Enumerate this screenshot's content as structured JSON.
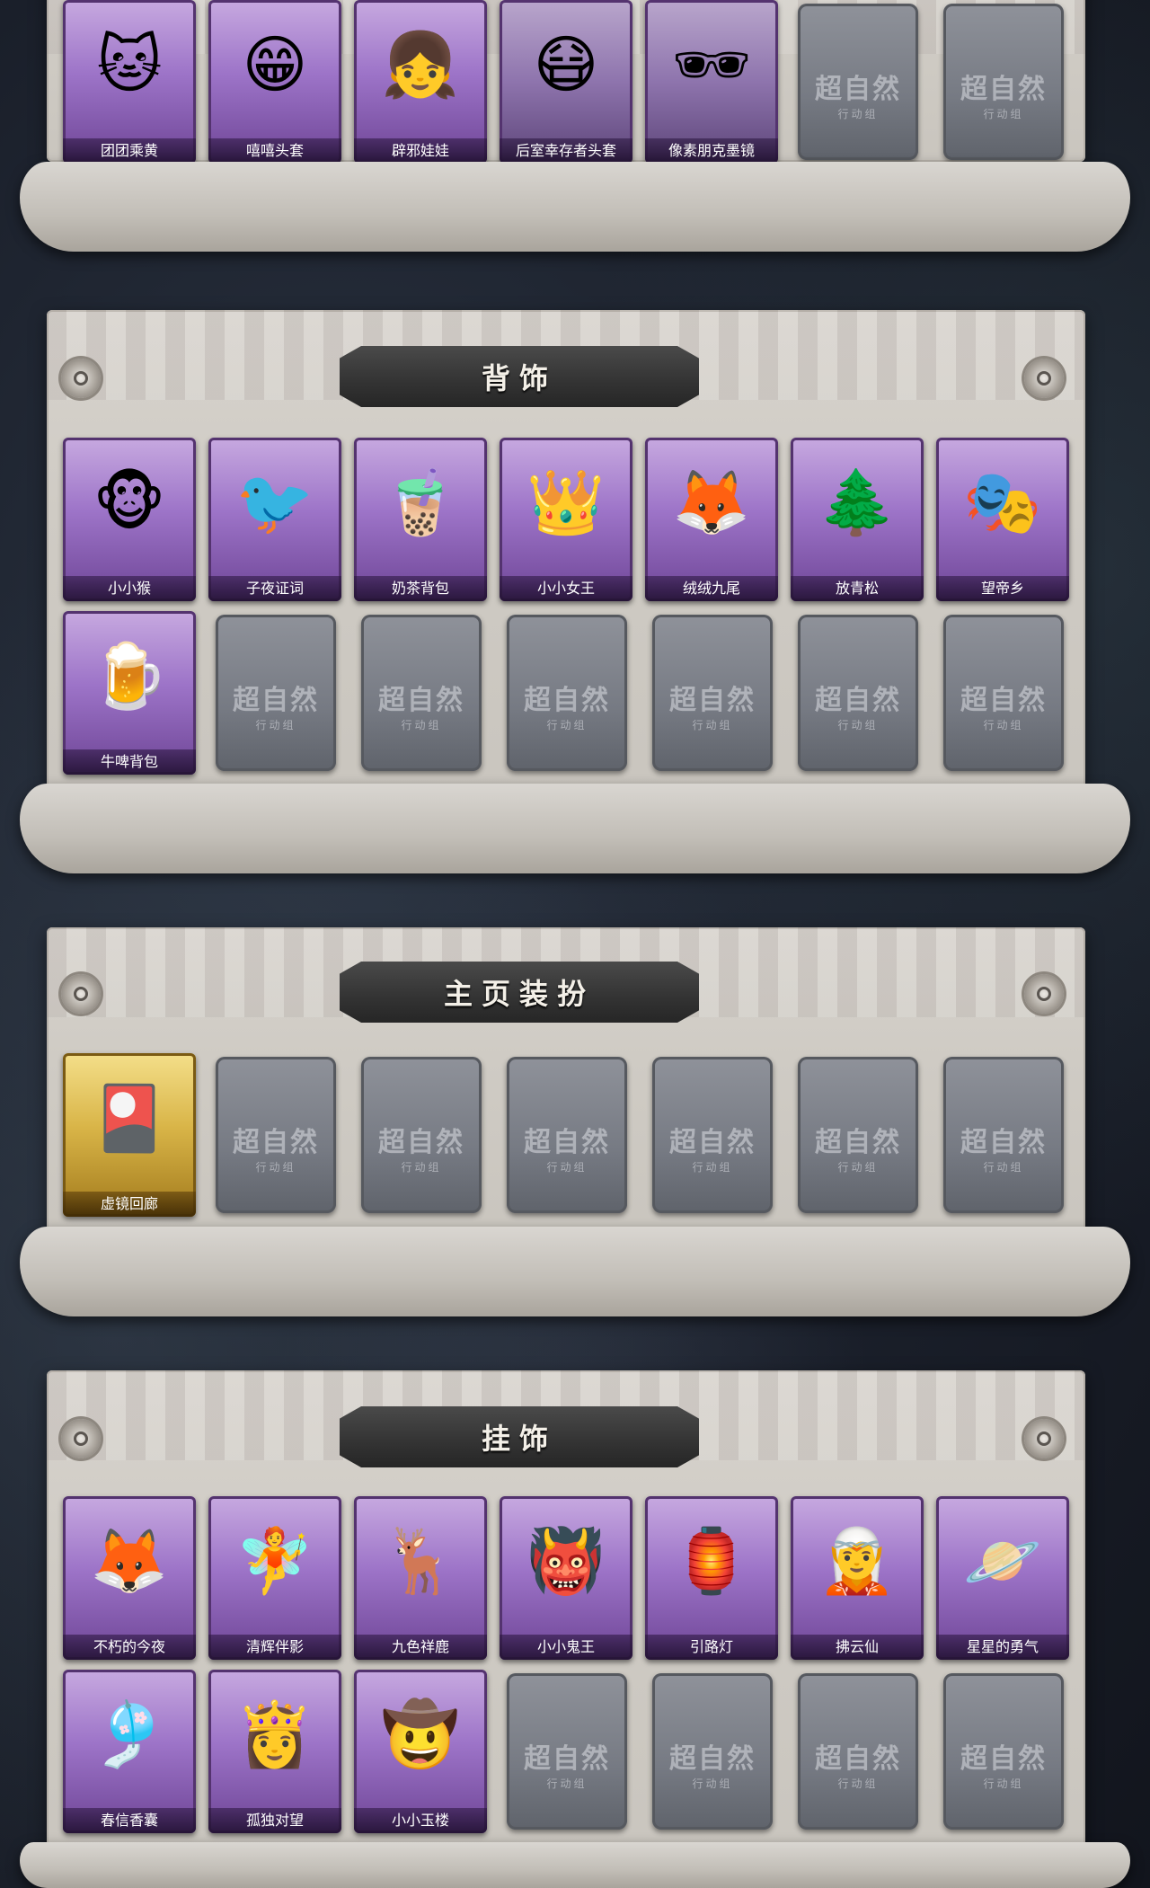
{
  "sections": [
    {
      "title": "",
      "items": [
        {
          "label": "团团乘黄",
          "icon": "cat-plush-icon",
          "art": "🐱",
          "rarity": "purple"
        },
        {
          "label": "嘻嘻头套",
          "icon": "grin-face-icon",
          "art": "😁",
          "rarity": "purple"
        },
        {
          "label": "辟邪娃娃",
          "icon": "doll-face-icon",
          "art": "👧",
          "rarity": "purple"
        },
        {
          "label": "后室幸存者头套",
          "icon": "gas-mask-icon",
          "art": "😷",
          "rarity": "gray"
        },
        {
          "label": "像素朋克墨镜",
          "icon": "pixel-sunglasses-icon",
          "art": "🕶",
          "rarity": "gray"
        }
      ],
      "empty_slots": 2
    },
    {
      "title": "背饰",
      "items": [
        {
          "label": "小小猴",
          "icon": "monkey-icon",
          "art": "🐵",
          "rarity": "purple"
        },
        {
          "label": "子夜证词",
          "icon": "crow-icon",
          "art": "🐦",
          "rarity": "purple"
        },
        {
          "label": "奶茶背包",
          "icon": "milk-tea-bag-icon",
          "art": "🧋",
          "rarity": "purple"
        },
        {
          "label": "小小女王",
          "icon": "queen-icon",
          "art": "👑",
          "rarity": "purple"
        },
        {
          "label": "绒绒九尾",
          "icon": "fox-icon",
          "art": "🦊",
          "rarity": "purple"
        },
        {
          "label": "放青松",
          "icon": "pine-bonsai-icon",
          "art": "🌲",
          "rarity": "purple"
        },
        {
          "label": "望帝乡",
          "icon": "mask-figure-icon",
          "art": "🎭",
          "rarity": "purple"
        },
        {
          "label": "牛啤背包",
          "icon": "beer-barrel-icon",
          "art": "🍺",
          "rarity": "purple"
        }
      ],
      "empty_slots": 6
    },
    {
      "title": "主页装扮",
      "items": [
        {
          "label": "虚镜回廊",
          "icon": "mirror-card-icon",
          "art": "🎴",
          "rarity": "gold"
        }
      ],
      "empty_slots": 6
    },
    {
      "title": "挂饰",
      "items": [
        {
          "label": "不朽的今夜",
          "icon": "pink-fox-cup-icon",
          "art": "🦊",
          "rarity": "purple"
        },
        {
          "label": "清辉伴影",
          "icon": "moon-girl-icon",
          "art": "🧚",
          "rarity": "purple"
        },
        {
          "label": "九色祥鹿",
          "icon": "deer-icon",
          "art": "🦌",
          "rarity": "purple"
        },
        {
          "label": "小小鬼王",
          "icon": "demon-king-icon",
          "art": "👹",
          "rarity": "purple"
        },
        {
          "label": "引路灯",
          "icon": "lantern-icon",
          "art": "🏮",
          "rarity": "purple"
        },
        {
          "label": "拂云仙",
          "icon": "fairy-icon",
          "art": "🧝",
          "rarity": "purple"
        },
        {
          "label": "星星的勇气",
          "icon": "planet-girl-icon",
          "art": "🪐",
          "rarity": "purple"
        },
        {
          "label": "春信香囊",
          "icon": "sachet-icon",
          "art": "🎐",
          "rarity": "purple"
        },
        {
          "label": "孤独对望",
          "icon": "lonely-girl-icon",
          "art": "👸",
          "rarity": "purple"
        },
        {
          "label": "小小玉楼",
          "icon": "hat-boy-icon",
          "art": "🤠",
          "rarity": "purple"
        }
      ],
      "empty_slots": 4
    }
  ],
  "placeholder": {
    "logo_text": "超自然",
    "logo_sub": "行动组"
  },
  "colors": {
    "panel": "#d0ccc5",
    "purple_card": "#9d74c8",
    "gold_card": "#d9b548",
    "empty_card": "#767a83",
    "banner": "#333333"
  }
}
